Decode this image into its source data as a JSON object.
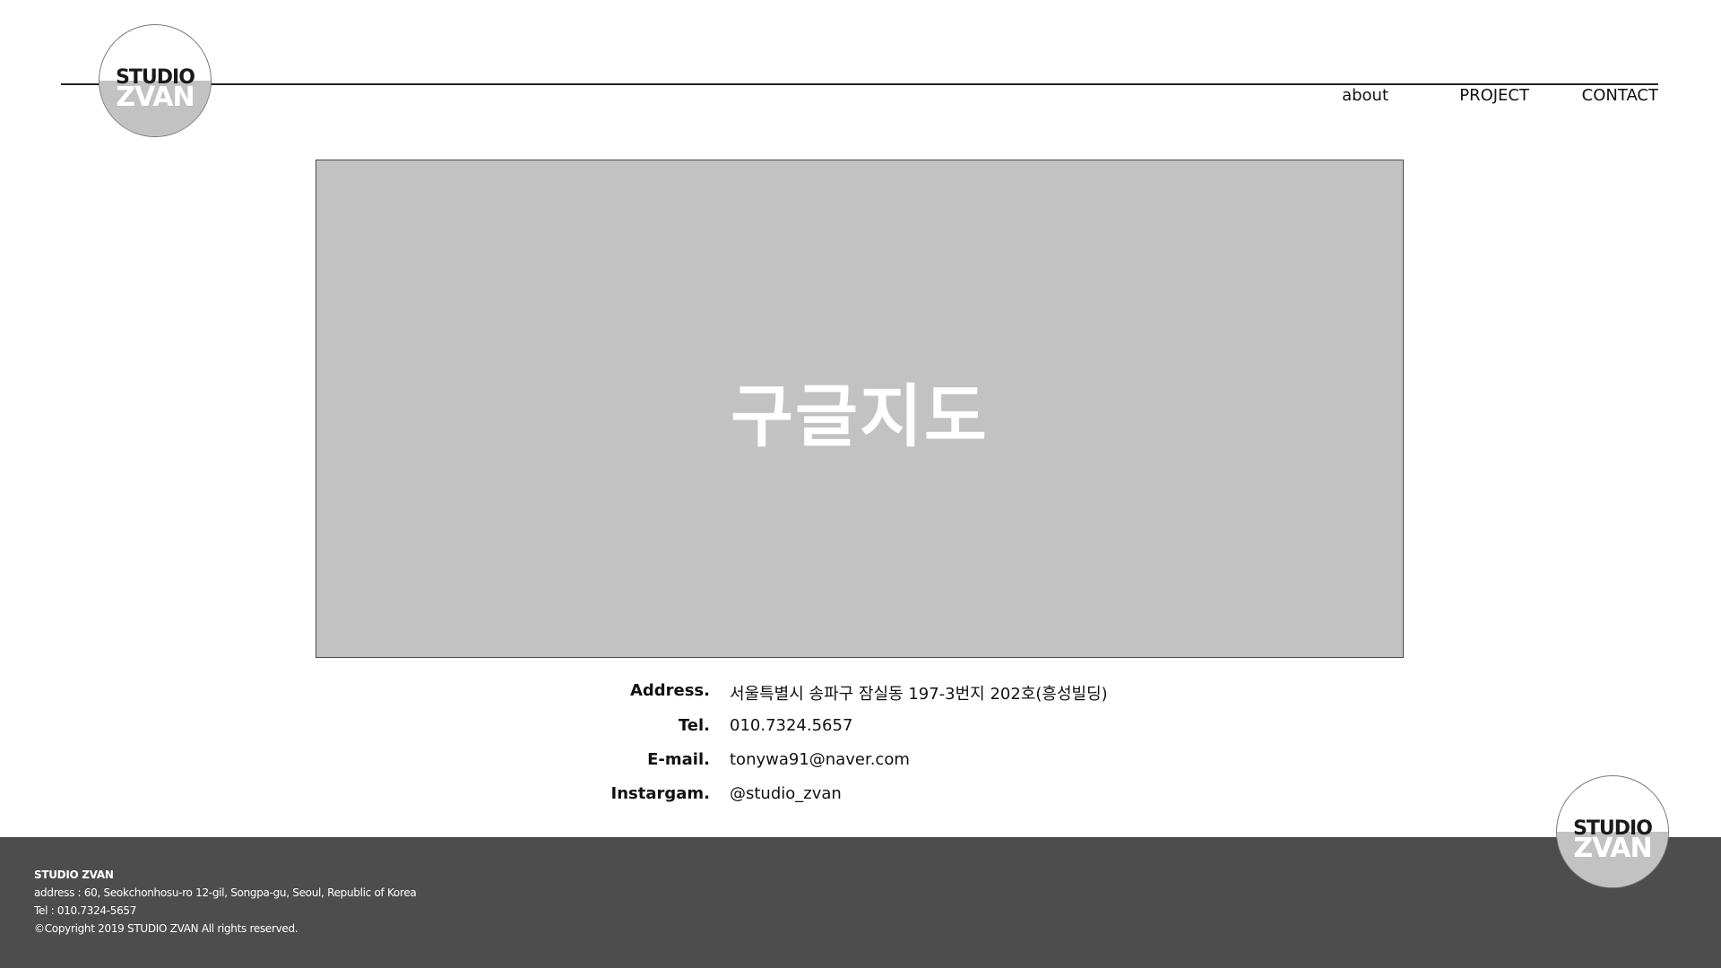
{
  "header": {
    "logo": {
      "line1": "STUDIO",
      "line2": "ZVAN"
    },
    "nav": [
      {
        "label": "about"
      },
      {
        "label": "PROJECT"
      },
      {
        "label": "CONTACT"
      }
    ]
  },
  "map": {
    "placeholder": "구글지도"
  },
  "contact": [
    {
      "label": "Address.",
      "value": "서울특별시 송파구 잠실동 197-3번지 202호(흥성빌딩)"
    },
    {
      "label": "Tel.",
      "value": "010.7324.5657"
    },
    {
      "label": "E-mail.",
      "value": "tonywa91@naver.com"
    },
    {
      "label": "Instargam.",
      "value": "@studio_zvan"
    }
  ],
  "footer": {
    "brand": "STUDIO ZVAN",
    "address": "address : 60, Seokchonhosu-ro 12-gil, Songpa-gu, Seoul, Republic of Korea",
    "tel": "Tel : 010.7324-5657",
    "copyright": "©Copyright 2019 STUDIO ZVAN All rights reserved.",
    "logo": {
      "line1": "STUDIO",
      "line2": "ZVAN"
    }
  },
  "colors": {
    "logo_lower": "#c3c2c3",
    "map_fill": "#c3c2c3",
    "footer_bg": "#4d4d4d",
    "line": "#222222"
  }
}
